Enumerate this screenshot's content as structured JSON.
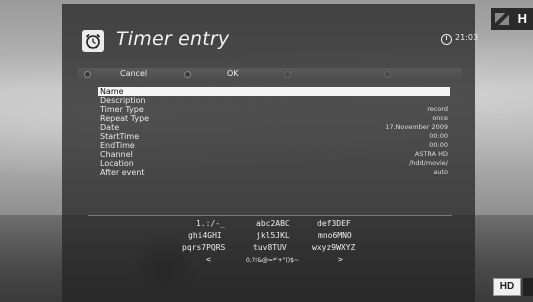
{
  "dialog": {
    "title": "Timer entry",
    "time": "21:03",
    "icon": "alarm-clock-icon"
  },
  "buttons": {
    "cancel_label": "Cancel",
    "ok_label": "OK"
  },
  "fields": [
    {
      "label": "Name",
      "value": ""
    },
    {
      "label": "Description",
      "value": ""
    },
    {
      "label": "Timer Type",
      "value": "record"
    },
    {
      "label": "Repeat Type",
      "value": "once"
    },
    {
      "label": "Date",
      "value": "17.November 2009"
    },
    {
      "label": "StartTime",
      "value": "00:00"
    },
    {
      "label": "EndTime",
      "value": "00:00"
    },
    {
      "label": "Channel",
      "value": "ASTRA HD"
    },
    {
      "label": "Location",
      "value": "/hdd/movie/"
    },
    {
      "label": "After event",
      "value": "auto"
    }
  ],
  "keyboard": {
    "rows": [
      [
        "1.:/-_",
        "abc2ABC",
        "def3DEF"
      ],
      [
        "ghi4GHI",
        "jkl5JKL",
        "mno6MNO"
      ],
      [
        "pqrs7PQRS",
        "tuv8TUV",
        "wxyz9WXYZ"
      ],
      [
        "<",
        "0,?!&@=*'+\"()$~",
        ">"
      ]
    ]
  },
  "overlay": {
    "hd_badge": "HD",
    "channel_logo": "H"
  }
}
